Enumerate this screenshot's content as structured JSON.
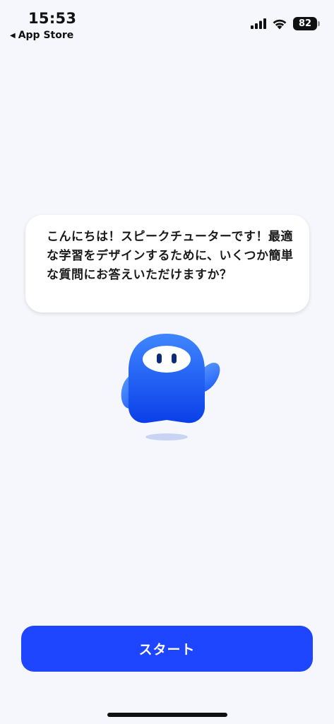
{
  "status_bar": {
    "time": "15:53",
    "back_label": "App Store",
    "battery": "82"
  },
  "bubble": {
    "message": "こんにちは！スピークチューターです！最適な学習をデザインするために、いくつか簡単な質問にお答えいただけますか？"
  },
  "mascot": {
    "icon": "blue-ghost-mascot-icon",
    "color": "#1f5cff"
  },
  "start_button": {
    "label": "スタート",
    "color": "#1e45ff"
  }
}
